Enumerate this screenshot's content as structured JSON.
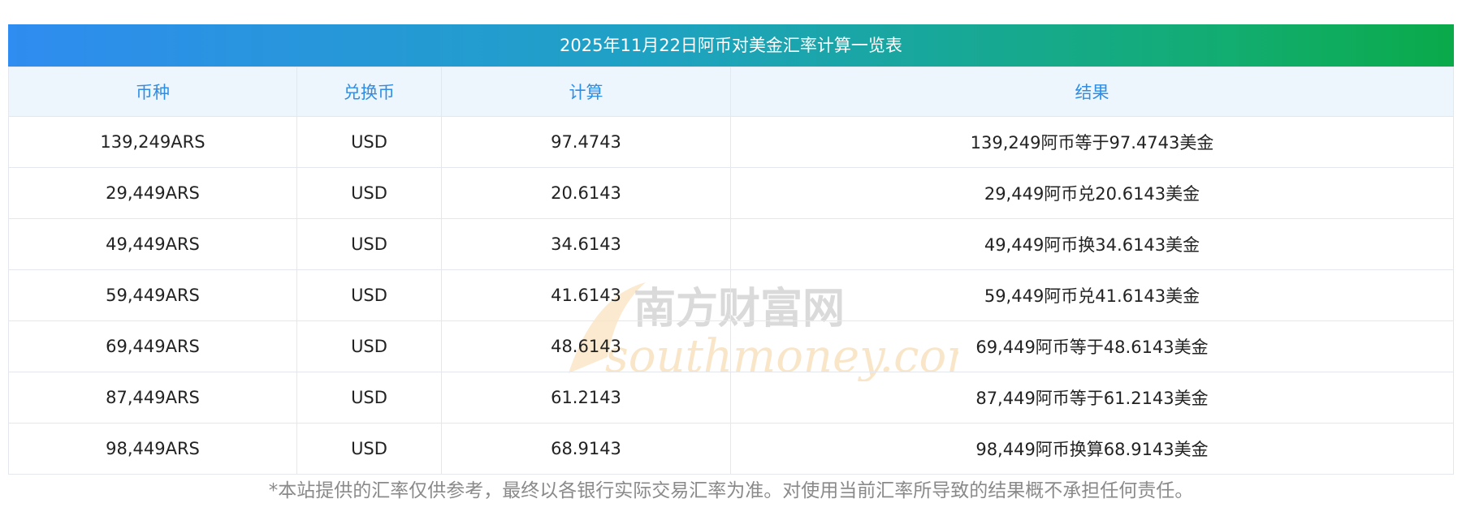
{
  "title": "2025年11月22日阿币对美金汇率计算一览表",
  "headers": [
    "币种",
    "兑换币",
    "计算",
    "结果"
  ],
  "rows": [
    [
      "139,249ARS",
      "USD",
      "97.4743",
      "139,249阿币等于97.4743美金"
    ],
    [
      "29,449ARS",
      "USD",
      "20.6143",
      "29,449阿币兑20.6143美金"
    ],
    [
      "49,449ARS",
      "USD",
      "34.6143",
      "49,449阿币换34.6143美金"
    ],
    [
      "59,449ARS",
      "USD",
      "41.6143",
      "59,449阿币兑41.6143美金"
    ],
    [
      "69,449ARS",
      "USD",
      "48.6143",
      "69,449阿币等于48.6143美金"
    ],
    [
      "87,449ARS",
      "USD",
      "61.2143",
      "87,449阿币等于61.2143美金"
    ],
    [
      "98,449ARS",
      "USD",
      "68.9143",
      "98,449阿币换算68.9143美金"
    ]
  ],
  "watermark": {
    "cn": "南方财富网",
    "en": "southmoney.com"
  },
  "footnote": "*本站提供的汇率仅供参考，最终以各银行实际交易汇率为准。对使用当前汇率所导致的结果概不承担任何责任。",
  "colors": {
    "header_text": "#2f8de4",
    "header_bg": "#edf5fd",
    "gradient_start": "#2f8cf0",
    "gradient_end": "#0aaa4a"
  }
}
